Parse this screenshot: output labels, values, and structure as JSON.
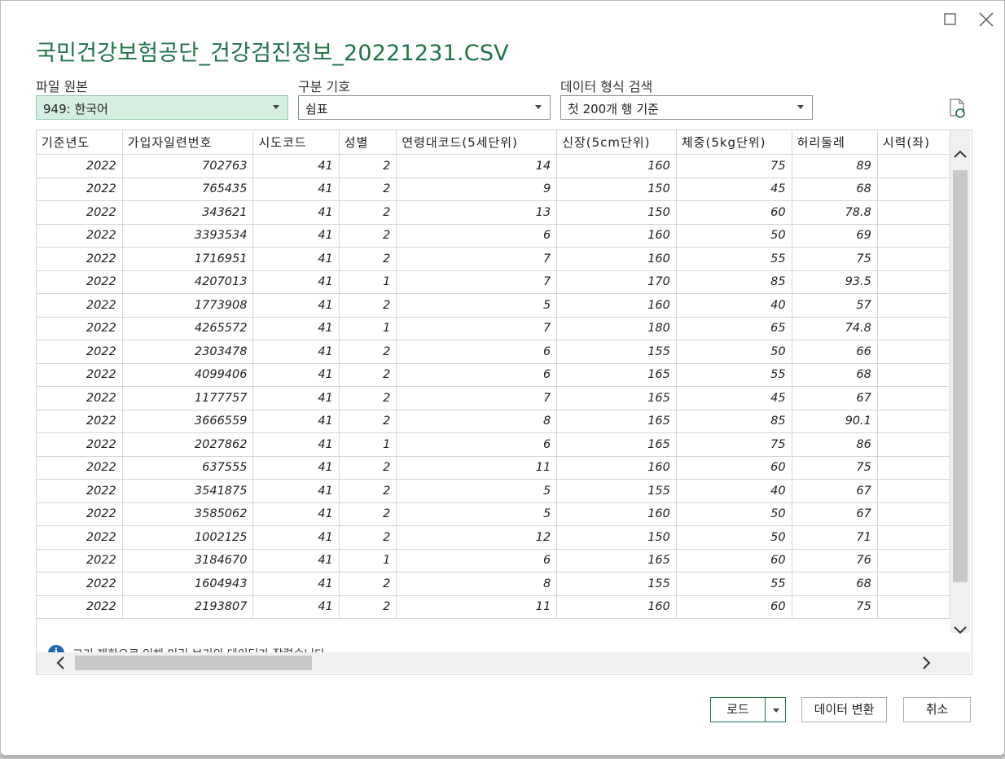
{
  "dialog": {
    "title": "국민건강보험공단_건강검진정보_20221231.CSV"
  },
  "file_origin": {
    "label": "파일 원본",
    "value": "949: 한국어"
  },
  "delimiter": {
    "label": "구분 기호",
    "value": "쉼표"
  },
  "detection": {
    "label": "데이터 형식 검색",
    "value": "첫 200개 행 기준"
  },
  "icons": {
    "maximize": "maximize-icon",
    "close": "close-icon",
    "refresh": "refresh-icon",
    "info": "info-icon"
  },
  "table": {
    "columns": [
      "기준년도",
      "가입자일련번호",
      "시도코드",
      "성별",
      "연령대코드(5세단위)",
      "신장(5cm단위)",
      "체중(5kg단위)",
      "허리둘레",
      "시력(좌)"
    ],
    "rows": [
      [
        "2022",
        "702763",
        "41",
        "2",
        "14",
        "160",
        "75",
        "89",
        ""
      ],
      [
        "2022",
        "765435",
        "41",
        "2",
        "9",
        "150",
        "45",
        "68",
        ""
      ],
      [
        "2022",
        "343621",
        "41",
        "2",
        "13",
        "150",
        "60",
        "78.8",
        ""
      ],
      [
        "2022",
        "3393534",
        "41",
        "2",
        "6",
        "160",
        "50",
        "69",
        ""
      ],
      [
        "2022",
        "1716951",
        "41",
        "2",
        "7",
        "160",
        "55",
        "75",
        ""
      ],
      [
        "2022",
        "4207013",
        "41",
        "1",
        "7",
        "170",
        "85",
        "93.5",
        ""
      ],
      [
        "2022",
        "1773908",
        "41",
        "2",
        "5",
        "160",
        "40",
        "57",
        ""
      ],
      [
        "2022",
        "4265572",
        "41",
        "1",
        "7",
        "180",
        "65",
        "74.8",
        ""
      ],
      [
        "2022",
        "2303478",
        "41",
        "2",
        "6",
        "155",
        "50",
        "66",
        ""
      ],
      [
        "2022",
        "4099406",
        "41",
        "2",
        "6",
        "165",
        "55",
        "68",
        ""
      ],
      [
        "2022",
        "1177757",
        "41",
        "2",
        "7",
        "165",
        "45",
        "67",
        ""
      ],
      [
        "2022",
        "3666559",
        "41",
        "2",
        "8",
        "165",
        "85",
        "90.1",
        ""
      ],
      [
        "2022",
        "2027862",
        "41",
        "1",
        "6",
        "165",
        "75",
        "86",
        ""
      ],
      [
        "2022",
        "637555",
        "41",
        "2",
        "11",
        "160",
        "60",
        "75",
        ""
      ],
      [
        "2022",
        "3541875",
        "41",
        "2",
        "5",
        "155",
        "40",
        "67",
        ""
      ],
      [
        "2022",
        "3585062",
        "41",
        "2",
        "5",
        "160",
        "50",
        "67",
        ""
      ],
      [
        "2022",
        "1002125",
        "41",
        "2",
        "12",
        "150",
        "50",
        "71",
        ""
      ],
      [
        "2022",
        "3184670",
        "41",
        "1",
        "6",
        "165",
        "60",
        "76",
        ""
      ],
      [
        "2022",
        "1604943",
        "41",
        "2",
        "8",
        "155",
        "55",
        "68",
        ""
      ],
      [
        "2022",
        "2193807",
        "41",
        "2",
        "11",
        "160",
        "60",
        "75",
        ""
      ]
    ]
  },
  "notice": {
    "text": "크기 제한으로 인해 미리 보기의 데이터가 잘렸습니다."
  },
  "buttons": {
    "load": "로드",
    "transform": "데이터 변환",
    "cancel": "취소"
  },
  "colors": {
    "accent": "#217346",
    "selected_fill": "#d4efdf",
    "info": "#1e64b4"
  }
}
